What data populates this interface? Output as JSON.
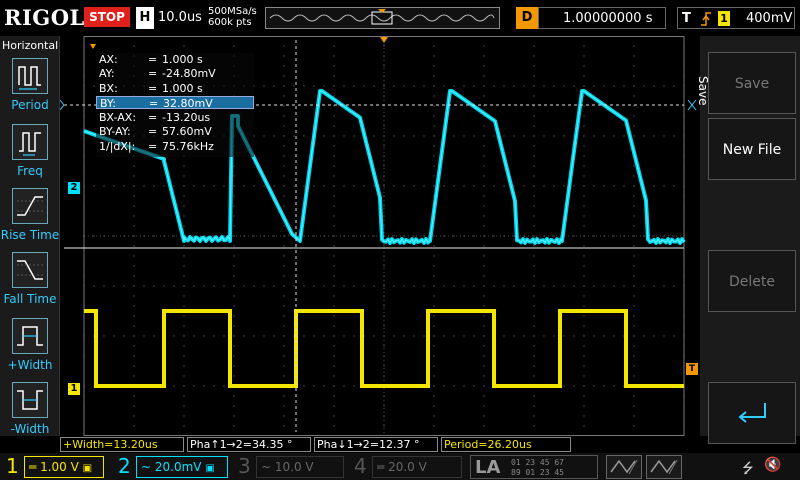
{
  "header": {
    "logo": "RIGOL",
    "run_state": "STOP",
    "timebase_label": "H",
    "timebase_value": "10.0us",
    "sample_rate": "500MSa/s",
    "memory_depth": "600k pts",
    "trigger_delay_label": "D",
    "trigger_delay_value": "1.00000000 s",
    "trigger_type_label": "T",
    "trigger_source": "1",
    "trigger_level": "400mV"
  },
  "left_panel": {
    "title": "Horizontal",
    "items": [
      {
        "label": "Period",
        "icon": "period-icon"
      },
      {
        "label": "Freq",
        "icon": "frequency-icon"
      },
      {
        "label": "Rise Time",
        "icon": "rise-time-icon"
      },
      {
        "label": "Fall Time",
        "icon": "fall-time-icon"
      },
      {
        "label": "+Width",
        "icon": "positive-width-icon"
      },
      {
        "label": "-Width",
        "icon": "negative-width-icon"
      }
    ]
  },
  "cursor_readout": {
    "rows": [
      {
        "key": "AX:",
        "value": "1.000 s"
      },
      {
        "key": "AY:",
        "value": "-24.80mV"
      },
      {
        "key": "BX:",
        "value": "1.000 s"
      },
      {
        "key": "BY:",
        "value": "32.80mV"
      },
      {
        "key": "BX-AX:",
        "value": "-13.20us"
      },
      {
        "key": "BY-AY:",
        "value": "57.60mV"
      },
      {
        "key": "1/|dX|:",
        "value": "75.76kHz"
      }
    ],
    "equals": "=",
    "selected_row": 3
  },
  "channel_markers": {
    "ch1": "1",
    "ch2": "2",
    "trigger": "T"
  },
  "right_panel": {
    "tab": "Save",
    "buttons": [
      {
        "label": "Save",
        "active": false
      },
      {
        "label": "New File",
        "active": true
      },
      {
        "label": "Delete",
        "active": false
      },
      {
        "label": "",
        "icon": "enter-arrow-icon",
        "active": true
      }
    ]
  },
  "measurements": [
    {
      "text": "+Width=13.20us",
      "color": "#f5e600"
    },
    {
      "text": "Pha↑1→2=34.35 °",
      "color": "#ffffff"
    },
    {
      "text": "Pha↓1→2=12.37 °",
      "color": "#ffffff"
    },
    {
      "text": "Period=26.20us",
      "color": "#f5e600"
    }
  ],
  "channels": [
    {
      "num": "1",
      "scale": "1.00 V",
      "coupling": "DC",
      "color": "#f5e600",
      "active": true
    },
    {
      "num": "2",
      "scale": "20.0mV",
      "coupling": "AC",
      "color": "#00e0ff",
      "active": true
    },
    {
      "num": "3",
      "scale": "10.0 V",
      "coupling": "AC",
      "color": "#555555",
      "active": false
    },
    {
      "num": "4",
      "scale": "20.0 V",
      "coupling": "DC",
      "color": "#555555",
      "active": false
    }
  ],
  "la": {
    "label": "LA",
    "row1": "01 23 45 67",
    "row2": "89 01 23 45"
  },
  "colors": {
    "ch1": "#f5e600",
    "ch2": "#00e0ff",
    "accent": "#f39800",
    "stop": "#e0201a"
  }
}
